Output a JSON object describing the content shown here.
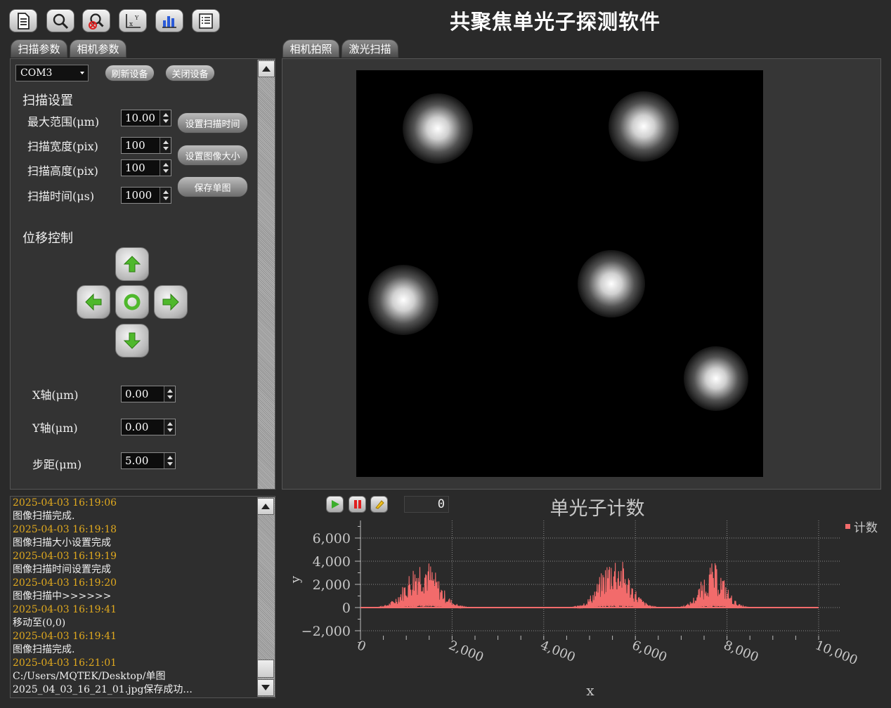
{
  "app": {
    "title": "共聚焦单光子探测软件"
  },
  "toolbar": {
    "icons": [
      "document-icon",
      "search-icon",
      "search-remove-icon",
      "axis-icon",
      "bar-chart-icon",
      "list-icon"
    ]
  },
  "left_tabs": [
    "扫描参数",
    "相机参数"
  ],
  "right_tabs": [
    "相机拍照",
    "激光扫描"
  ],
  "device": {
    "port": "COM3",
    "refresh_label": "刷新设备",
    "close_label": "关闭设备"
  },
  "scan": {
    "section_title": "扫描设置",
    "rows": [
      {
        "label": "最大范围(μm)",
        "value": "10.00"
      },
      {
        "label": "扫描宽度(pix)",
        "value": "100"
      },
      {
        "label": "扫描高度(pix)",
        "value": "100"
      },
      {
        "label": "扫描时间(μs)",
        "value": "1000"
      }
    ],
    "buttons": [
      "设置扫描时间",
      "设置图像大小",
      "保存单图"
    ]
  },
  "motion": {
    "section_title": "位移控制",
    "x_label": "X轴(μm)",
    "x_value": "0.00",
    "y_label": "Y轴(μm)",
    "y_value": "0.00",
    "step_label": "步距(μm)",
    "step_value": "5.00"
  },
  "log": [
    {
      "time": "2025-04-03 16:19:06",
      "msg": [
        "图像扫描完成."
      ]
    },
    {
      "time": "2025-04-03 16:19:18",
      "msg": [
        "图像扫描大小设置完成"
      ]
    },
    {
      "time": "2025-04-03 16:19:19",
      "msg": [
        "图像扫描时间设置完成"
      ]
    },
    {
      "time": "2025-04-03 16:19:20",
      "msg": [
        "图像扫描中>>>>>>"
      ]
    },
    {
      "time": "2025-04-03 16:19:41",
      "msg": [
        "移动至(0,0)"
      ]
    },
    {
      "time": "2025-04-03 16:19:41",
      "msg": [
        "图像扫描完成."
      ]
    },
    {
      "time": "2025-04-03 16:21:01",
      "msg": [
        "C:/Users/MQTEK/Desktop/单图",
        "2025_04_03_16_21_01.jpg保存成功..."
      ]
    }
  ],
  "player": {
    "counter": "0"
  },
  "colors": {
    "series": "#f26b6b",
    "timestamp": "#e0a91e",
    "background": "#2a2a2a"
  },
  "chart_data": {
    "type": "line",
    "title": "单光子计数",
    "xlabel": "x",
    "ylabel": "y",
    "xlim": [
      0,
      10000
    ],
    "ylim": [
      -3000,
      7500
    ],
    "xticks": [
      0,
      2000,
      4000,
      6000,
      8000,
      10000
    ],
    "xtick_labels": [
      "0",
      "2,000",
      "4,000",
      "6,000",
      "8,000",
      "10,000"
    ],
    "yticks": [
      -2000,
      0,
      2000,
      4000,
      6000
    ],
    "ytick_labels": [
      "−2,000",
      "0",
      "2,000",
      "4,000",
      "6,000"
    ],
    "grid": true,
    "legend": "top-right",
    "series": [
      {
        "name": "计数",
        "envelope": [
          {
            "center": 1350,
            "width": 850,
            "peak": 4500
          },
          {
            "center": 5550,
            "width": 800,
            "peak": 4700
          },
          {
            "center": 7700,
            "width": 650,
            "peak": 3900
          }
        ],
        "baseline": 0
      }
    ]
  }
}
